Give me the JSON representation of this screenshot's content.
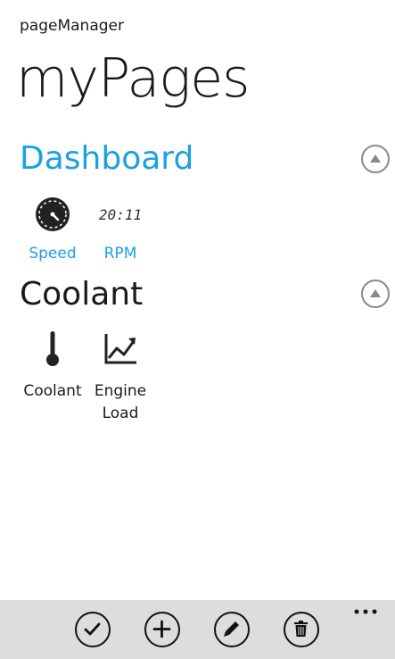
{
  "app": {
    "name": "pageManager",
    "title": "myPages"
  },
  "groups": [
    {
      "title": "Dashboard",
      "title_color": "#1ba1e2",
      "collapse_icon": "chevron-up-icon",
      "tiles": [
        {
          "label": "Speed",
          "icon": "speedometer-icon"
        },
        {
          "label": "RPM",
          "icon": "digital-clock-icon",
          "icon_text": "20:11"
        }
      ]
    },
    {
      "title": "Coolant",
      "title_color": "#1a1a1a",
      "collapse_icon": "chevron-up-icon",
      "tiles": [
        {
          "label": "Coolant",
          "icon": "thermometer-icon"
        },
        {
          "label": "EngineLoad",
          "icon": "line-chart-icon"
        }
      ]
    }
  ],
  "appbar": {
    "background": "#dddddd",
    "buttons": [
      {
        "icon": "check-icon"
      },
      {
        "icon": "plus-icon"
      },
      {
        "icon": "pencil-icon"
      },
      {
        "icon": "trash-icon"
      }
    ],
    "more_icon": "more-dots-icon"
  }
}
